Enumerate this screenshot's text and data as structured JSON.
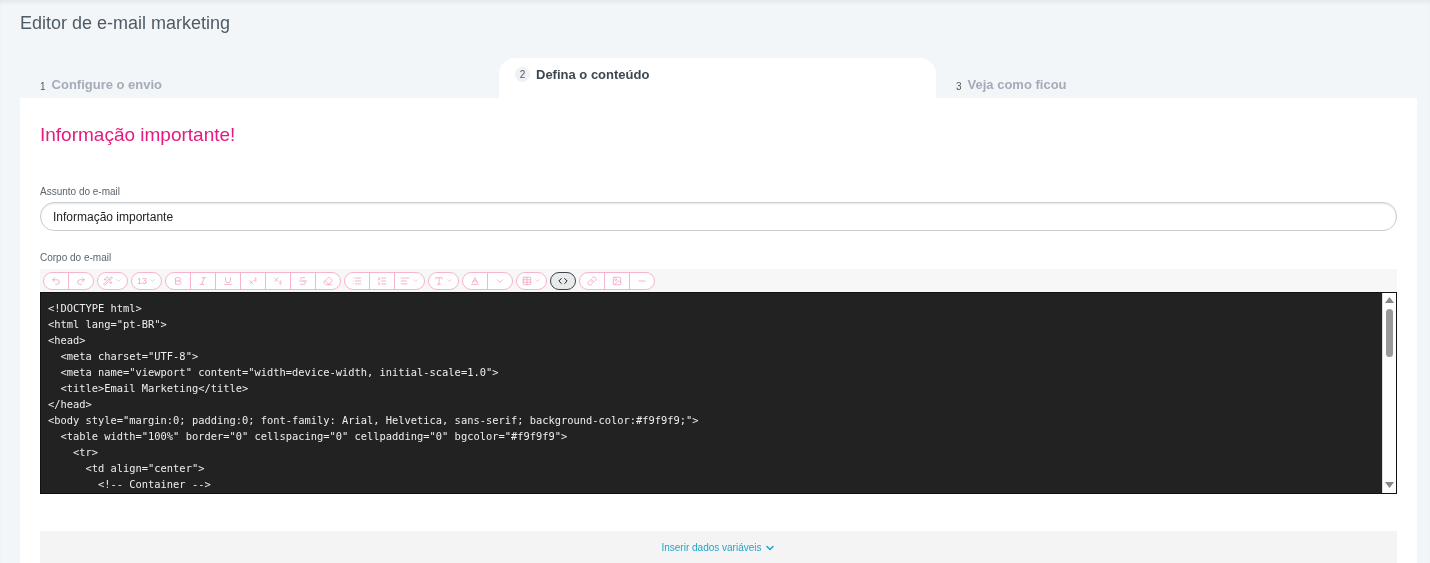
{
  "page_title": "Editor de e-mail marketing",
  "steps": [
    {
      "number": "1",
      "label": "Configure o envio",
      "selected": false
    },
    {
      "number": "2",
      "label": "Defina o conteúdo",
      "selected": true
    },
    {
      "number": "3",
      "label": "Veja como ficou",
      "selected": false
    }
  ],
  "heading": "Informação importante!",
  "subject": {
    "label": "Assunto do e-mail",
    "value": "Informação importante"
  },
  "body": {
    "label": "Corpo do e-mail",
    "toolbar": [
      {
        "buttons": [
          {
            "kind": "undo",
            "selected": false
          },
          {
            "kind": "redo",
            "selected": false
          }
        ]
      },
      {
        "buttons": [
          {
            "kind": "style",
            "selected": false
          }
        ]
      },
      {
        "buttons": [
          {
            "kind": "size",
            "text": "13",
            "selected": false
          }
        ]
      },
      {
        "buttons": [
          {
            "kind": "bold",
            "selected": false
          },
          {
            "kind": "italic",
            "selected": false
          },
          {
            "kind": "underline",
            "selected": false
          },
          {
            "kind": "superscript",
            "selected": false
          },
          {
            "kind": "subscript",
            "selected": false
          },
          {
            "kind": "strike",
            "selected": false
          },
          {
            "kind": "eraser",
            "selected": false
          }
        ]
      },
      {
        "buttons": [
          {
            "kind": "bullets",
            "selected": false
          },
          {
            "kind": "numbers",
            "selected": false
          },
          {
            "kind": "align",
            "selected": false
          }
        ]
      },
      {
        "buttons": [
          {
            "kind": "heading",
            "selected": false
          }
        ]
      },
      {
        "buttons": [
          {
            "kind": "color",
            "selected": false
          },
          {
            "kind": "dropdown",
            "selected": false
          }
        ]
      },
      {
        "buttons": [
          {
            "kind": "table",
            "selected": false
          }
        ]
      },
      {
        "buttons": [
          {
            "kind": "code",
            "selected": true
          }
        ]
      },
      {
        "buttons": [
          {
            "kind": "link",
            "selected": false
          },
          {
            "kind": "image",
            "selected": false
          },
          {
            "kind": "rule",
            "selected": false
          }
        ]
      }
    ],
    "code_lines": [
      "<!DOCTYPE html>",
      "<html lang=\"pt-BR\">",
      "<head>",
      "  <meta charset=\"UTF-8\">",
      "  <meta name=\"viewport\" content=\"width=device-width, initial-scale=1.0\">",
      "  <title>Email Marketing</title>",
      "</head>",
      "<body style=\"margin:0; padding:0; font-family: Arial, Helvetica, sans-serif; background-color:#f9f9f9;\">",
      "  <table width=\"100%\" border=\"0\" cellspacing=\"0\" cellpadding=\"0\" bgcolor=\"#f9f9f9\">",
      "    <tr>",
      "      <td align=\"center\">",
      "        <!-- Container -->"
    ]
  },
  "insert_variables": "Inserir dados variáveis"
}
